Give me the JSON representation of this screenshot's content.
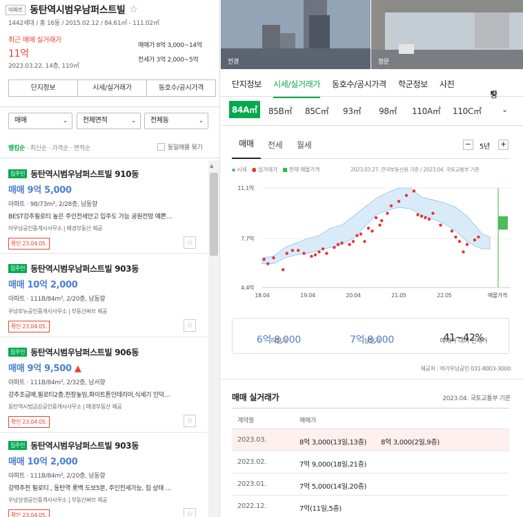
{
  "left": {
    "type_tag": "아파트",
    "title": "동탄역시범우남퍼스트빌",
    "summary": "1442세대 / 총 16동 / 2015.02.12 / 84.61㎡ - 111.02㎡",
    "recent_label": "최근 매매 실거래가",
    "recent_price": "11억",
    "recent_date": "2023.03.22, 14층, 110㎡",
    "sale_label": "매매가",
    "sale_range": "8억 3,000~14억",
    "jeonse_label": "전세가",
    "jeonse_range": "3억 2,000~5억",
    "buttons": [
      "단지정보",
      "시세/실거래가",
      "동호수/공시가격"
    ],
    "filters": [
      "매매",
      "전체면적",
      "전체동"
    ],
    "sort": [
      "랭킹순",
      "최신순",
      "가격순",
      "면적순"
    ],
    "bundle": "동일매물 묶기",
    "listings": [
      {
        "badge": "집주인",
        "name": "동탄역시범우남퍼스트빌 910동",
        "price": "매매 9억 5,000",
        "spec": "아파트 · 98/73m², 2/28층, 남동향",
        "desc": "BEST강추필로티 높은 주인전세안고 입주도 가능 공원전망 예쁜…",
        "agent": "아우남공인중개사사무소 | 매경부동산 제공",
        "check": "확인 23.04.05."
      },
      {
        "badge": "집주인",
        "name": "동탄역시범우남퍼스트빌 903동",
        "price": "매매 10억 2,000",
        "spec": "아파트 · 111B/84m², 2/20층, 남동향",
        "desc": "",
        "agent": "우남로뉴공인중개사사무소 | 부동산써브 제공",
        "check": "확인 23.04.05."
      },
      {
        "badge": "집주인",
        "name": "동탄역시범우남퍼스트빌 906동",
        "price": "매매 9억 9,500",
        "spec": "아파트 · 111B/84m², 2/32층, 남서향",
        "desc": "강추초급매,필로티2층,천장높임,화이트톤인테리어,식세기 인덕…",
        "agent": "동탄역시범금강공인중개사사무소 | 매경부동산 제공",
        "check": "확인 23.04.05."
      },
      {
        "badge": "집주인",
        "name": "동탄역시범우남퍼스트빌 903동",
        "price": "매매 10억 2,000",
        "spec": "아파트 · 111B/84m², 2/20층, 남동향",
        "desc": "강력추천 필로티 , 동탄역 롯백 도보5분, 주인전세가능, 집 상태 …",
        "agent": "우남상생공인중개사사무소 | 부동산써브 제공",
        "check": "확인 23.04.05."
      }
    ]
  },
  "right": {
    "photo1": "전경",
    "photo2": "정문",
    "tabs": [
      "단지정보",
      "시세/실거래가",
      "동호수/공시가격",
      "학군정보",
      "사진"
    ],
    "tab_more": "평",
    "areas": [
      "84A㎡",
      "85B㎡",
      "85C㎡",
      "93㎡",
      "98㎡",
      "110A㎡",
      "110C㎡"
    ],
    "subtabs": [
      "매매",
      "전세",
      "월세"
    ],
    "period": "5년",
    "legend": [
      "시세",
      "실거래가",
      "현재 매물가격"
    ],
    "source": "2023.03.27. 한국부동산원 기준 / 2023.04. 국토교통부 기준",
    "stats": [
      {
        "v": "6억 8,000",
        "k": "하한가"
      },
      {
        "v": "7억 8,000",
        "k": "상한가"
      },
      {
        "v": "41~42%",
        "k": "매매가 대비 전세가"
      }
    ],
    "provider": "제공처 : 여기우남공인 031-8003-3000",
    "deals_title": "매매 실거래가",
    "deals_src": "2023.04. 국토교통부 기준",
    "deals_head": [
      "계약월",
      "매매가"
    ],
    "deals": [
      {
        "m": "2023.03.",
        "p": "8억 3,000(13일,13층)",
        "p2": "8억 3,000(2일,9층)"
      },
      {
        "m": "2023.02.",
        "p": "7억 9,000(18일,21층)",
        "p2": ""
      },
      {
        "m": "2023.01.",
        "p": "7억 5,000(14일,20층)",
        "p2": ""
      },
      {
        "m": "2022.12.",
        "p": "7억(11일,5층)",
        "p2": ""
      }
    ]
  },
  "chart_data": {
    "type": "line",
    "xlabels": [
      "18.04",
      "19.04",
      "20.04",
      "21.05",
      "22.05",
      "매물가격"
    ],
    "ytick_labels": [
      "11.1억",
      "7.7억",
      "4.4억"
    ],
    "ylim": [
      4.4,
      11.1
    ],
    "band_upper": [
      [
        0,
        6.4
      ],
      [
        3,
        6.5
      ],
      [
        6,
        7.1
      ],
      [
        9,
        7.4
      ],
      [
        12,
        7.7
      ],
      [
        15,
        7.9
      ],
      [
        18,
        8.4
      ],
      [
        21,
        8.6
      ],
      [
        24,
        9.2
      ],
      [
        27,
        9.8
      ],
      [
        30,
        10.4
      ],
      [
        33,
        10.8
      ],
      [
        36,
        11.1
      ],
      [
        39,
        11.1
      ],
      [
        42,
        10.5
      ],
      [
        45,
        10.3
      ],
      [
        48,
        10.1
      ],
      [
        51,
        9.8
      ],
      [
        54,
        9.2
      ],
      [
        56,
        8.6
      ],
      [
        58,
        8.0
      ],
      [
        60,
        7.8
      ]
    ],
    "band_lower": [
      [
        0,
        6.0
      ],
      [
        3,
        6.0
      ],
      [
        6,
        6.4
      ],
      [
        9,
        6.6
      ],
      [
        12,
        6.7
      ],
      [
        15,
        6.9
      ],
      [
        18,
        7.1
      ],
      [
        21,
        7.3
      ],
      [
        24,
        7.7
      ],
      [
        27,
        8.5
      ],
      [
        30,
        9.3
      ],
      [
        33,
        9.6
      ],
      [
        36,
        9.8
      ],
      [
        39,
        9.7
      ],
      [
        42,
        9.3
      ],
      [
        45,
        9.0
      ],
      [
        48,
        8.7
      ],
      [
        51,
        8.2
      ],
      [
        54,
        7.5
      ],
      [
        56,
        7.2
      ],
      [
        58,
        7.0
      ],
      [
        60,
        7.0
      ]
    ],
    "deals": [
      [
        0.5,
        6.3
      ],
      [
        1.5,
        6.0
      ],
      [
        3.0,
        6.4
      ],
      [
        5.5,
        5.6
      ],
      [
        6.5,
        6.7
      ],
      [
        8,
        6.9
      ],
      [
        9.5,
        6.9
      ],
      [
        11,
        6.7
      ],
      [
        13,
        6.5
      ],
      [
        14,
        6.6
      ],
      [
        15,
        6.8
      ],
      [
        16,
        7.0
      ],
      [
        17,
        6.7
      ],
      [
        19,
        7.1
      ],
      [
        20,
        7.3
      ],
      [
        21,
        7.4
      ],
      [
        23,
        7.3
      ],
      [
        24,
        7.5
      ],
      [
        25,
        7.9
      ],
      [
        26,
        8.0
      ],
      [
        27,
        7.5
      ],
      [
        28,
        8.4
      ],
      [
        29,
        8.2
      ],
      [
        30,
        9.1
      ],
      [
        31,
        8.6
      ],
      [
        31.5,
        8.9
      ],
      [
        33,
        9.4
      ],
      [
        34,
        9.9
      ],
      [
        36,
        10.2
      ],
      [
        38,
        10.6
      ],
      [
        40,
        10.9
      ],
      [
        41,
        9.3
      ],
      [
        42,
        9.2
      ],
      [
        43,
        9.1
      ],
      [
        44,
        9.0
      ],
      [
        45,
        9.4
      ],
      [
        47,
        8.6
      ],
      [
        50,
        8.2
      ],
      [
        51,
        7.8
      ],
      [
        52,
        7.5
      ],
      [
        53,
        6.8
      ],
      [
        54,
        7.3
      ],
      [
        56,
        7.6
      ],
      [
        57,
        7.8
      ]
    ],
    "listing_range": [
      8.3,
      9.2
    ]
  }
}
